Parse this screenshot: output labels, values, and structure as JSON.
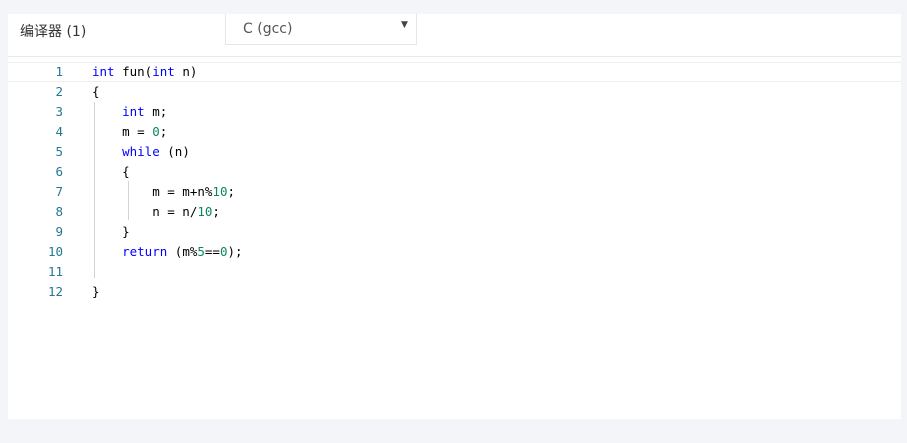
{
  "toolbar": {
    "compiler_label": "编译器 (1)",
    "language_select": {
      "value": "C (gcc)"
    }
  },
  "editor": {
    "lines": [
      {
        "number": "1",
        "tokens": [
          [
            "kw",
            "int"
          ],
          [
            "t",
            " fun("
          ],
          [
            "kw",
            "int"
          ],
          [
            "t",
            " n)"
          ]
        ]
      },
      {
        "number": "2",
        "tokens": [
          [
            "t",
            "{"
          ]
        ]
      },
      {
        "number": "3",
        "tokens": [
          [
            "t",
            "    "
          ],
          [
            "kw",
            "int"
          ],
          [
            "t",
            " m;"
          ]
        ]
      },
      {
        "number": "4",
        "tokens": [
          [
            "t",
            "    m = "
          ],
          [
            "num",
            "0"
          ],
          [
            "t",
            ";"
          ]
        ]
      },
      {
        "number": "5",
        "tokens": [
          [
            "t",
            "    "
          ],
          [
            "kw",
            "while"
          ],
          [
            "t",
            " (n)"
          ]
        ]
      },
      {
        "number": "6",
        "tokens": [
          [
            "t",
            "    {"
          ]
        ]
      },
      {
        "number": "7",
        "tokens": [
          [
            "t",
            "        m = m+n%"
          ],
          [
            "num",
            "10"
          ],
          [
            "t",
            ";"
          ]
        ]
      },
      {
        "number": "8",
        "tokens": [
          [
            "t",
            "        n = n/"
          ],
          [
            "num",
            "10"
          ],
          [
            "t",
            ";"
          ]
        ]
      },
      {
        "number": "9",
        "tokens": [
          [
            "t",
            "    }"
          ]
        ]
      },
      {
        "number": "10",
        "tokens": [
          [
            "t",
            "    "
          ],
          [
            "kw",
            "return"
          ],
          [
            "t",
            " (m%"
          ],
          [
            "num",
            "5"
          ],
          [
            "t",
            "=="
          ],
          [
            "num",
            "0"
          ],
          [
            "t",
            ");"
          ]
        ]
      },
      {
        "number": "11",
        "tokens": []
      },
      {
        "number": "12",
        "tokens": [
          [
            "t",
            "}"
          ]
        ]
      }
    ]
  },
  "colors": {
    "keyword": "#0000ff",
    "number": "#09885a",
    "line_number": "#237893"
  }
}
